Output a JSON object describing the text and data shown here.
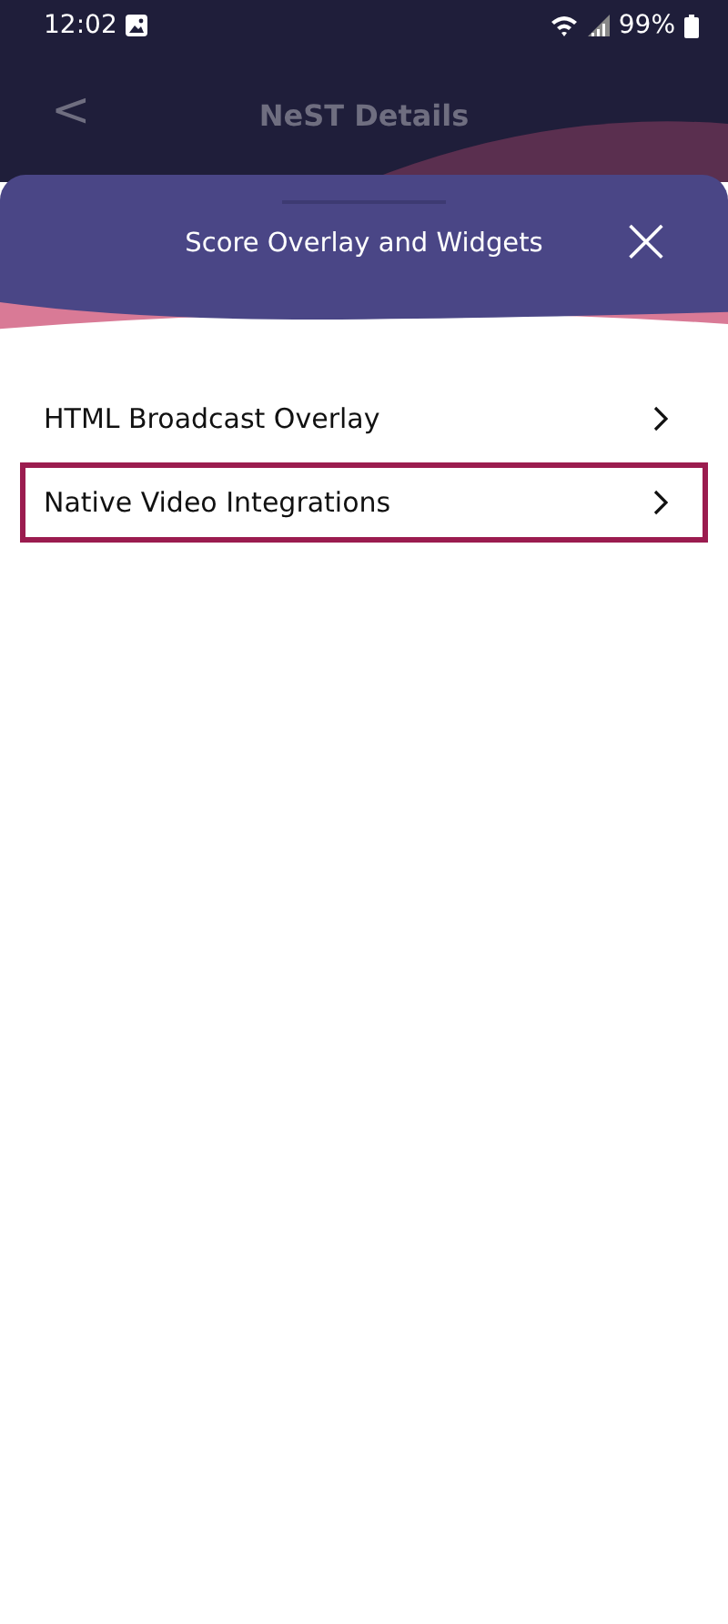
{
  "status_bar": {
    "time": "12:02",
    "battery": "99%"
  },
  "header": {
    "back": "<",
    "title": "NeST Details"
  },
  "sheet": {
    "title": "Score Overlay and Widgets",
    "close": "×"
  },
  "items": [
    {
      "label": "HTML Broadcast Overlay",
      "selected": false
    },
    {
      "label": "Native Video Integrations",
      "selected": true
    }
  ]
}
